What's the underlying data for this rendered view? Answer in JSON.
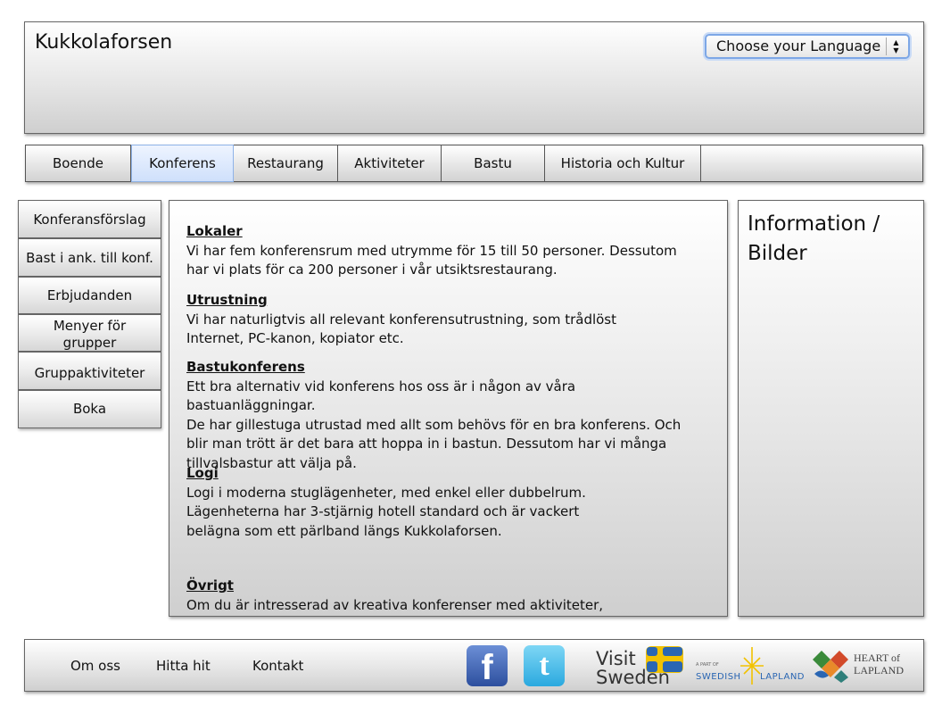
{
  "header": {
    "site_title": "Kukkolaforsen",
    "language_select": "Choose your Language"
  },
  "nav": {
    "tabs": [
      {
        "label": "Boende"
      },
      {
        "label": "Konferens",
        "active": true
      },
      {
        "label": "Restaurang"
      },
      {
        "label": "Aktiviteter"
      },
      {
        "label": "Bastu"
      },
      {
        "label": "Historia och Kultur"
      },
      {
        "label": ""
      }
    ]
  },
  "sidebar": {
    "items": [
      {
        "label": "Konferansförslag"
      },
      {
        "label": "Bast i ank. till konf."
      },
      {
        "label": "Erbjudanden"
      },
      {
        "label": "Menyer för grupper"
      },
      {
        "label": "Gruppaktiviteter"
      },
      {
        "label": "Boka"
      }
    ]
  },
  "content": {
    "sections": [
      {
        "heading": "Lokaler",
        "text": "Vi har fem konferensrum med utrymme för 15 till 50 personer. Dessutom\nhar vi plats för ca 200 personer i vår utsiktsrestaurang."
      },
      {
        "heading": "Utrustning",
        "text": "Vi har naturligtvis all relevant konferensutrustning, som trådlöst\nInternet, PC-kanon, kopiator etc."
      },
      {
        "heading": "Bastukonferens",
        "text": "Ett bra alternativ vid konferens hos oss är i någon av våra bastuanläggningar.\nDe har gillestuga utrustad med allt som behövs för en bra konferens. Och\nblir man trött är det bara att hoppa in i bastun. Dessutom har vi många\ntillvalsbastur att välja på."
      },
      {
        "heading": "Logi",
        "text": "Logi i moderna stuglägenheter, med enkel eller dubbelrum.\nLägenheterna har 3-stjärnig hotell standard och är vackert\nbelägna som ett pärlband längs Kukkolaforsen."
      },
      {
        "heading": "Övrigt",
        "text": "Om du är intresserad av kreativa konferenser med aktiviteter,"
      }
    ]
  },
  "info": {
    "title": "Information /\n Bilder"
  },
  "footer": {
    "links": [
      "Om oss",
      "Hitta hit",
      "Kontakt"
    ],
    "logos": {
      "visit_sweden": [
        "Visit",
        "Sweden"
      ],
      "swedish_lapland": [
        "A PART OF",
        "SWEDISH",
        "LAPLAND"
      ],
      "heart_of_lapland": [
        "HEART of",
        "LAPLAND"
      ]
    },
    "colors": {
      "facebook": "#3b5998",
      "twitter": "#33b5e5",
      "sweden_blue": "#2a66b3",
      "sweden_yellow": "#f2c200"
    }
  }
}
